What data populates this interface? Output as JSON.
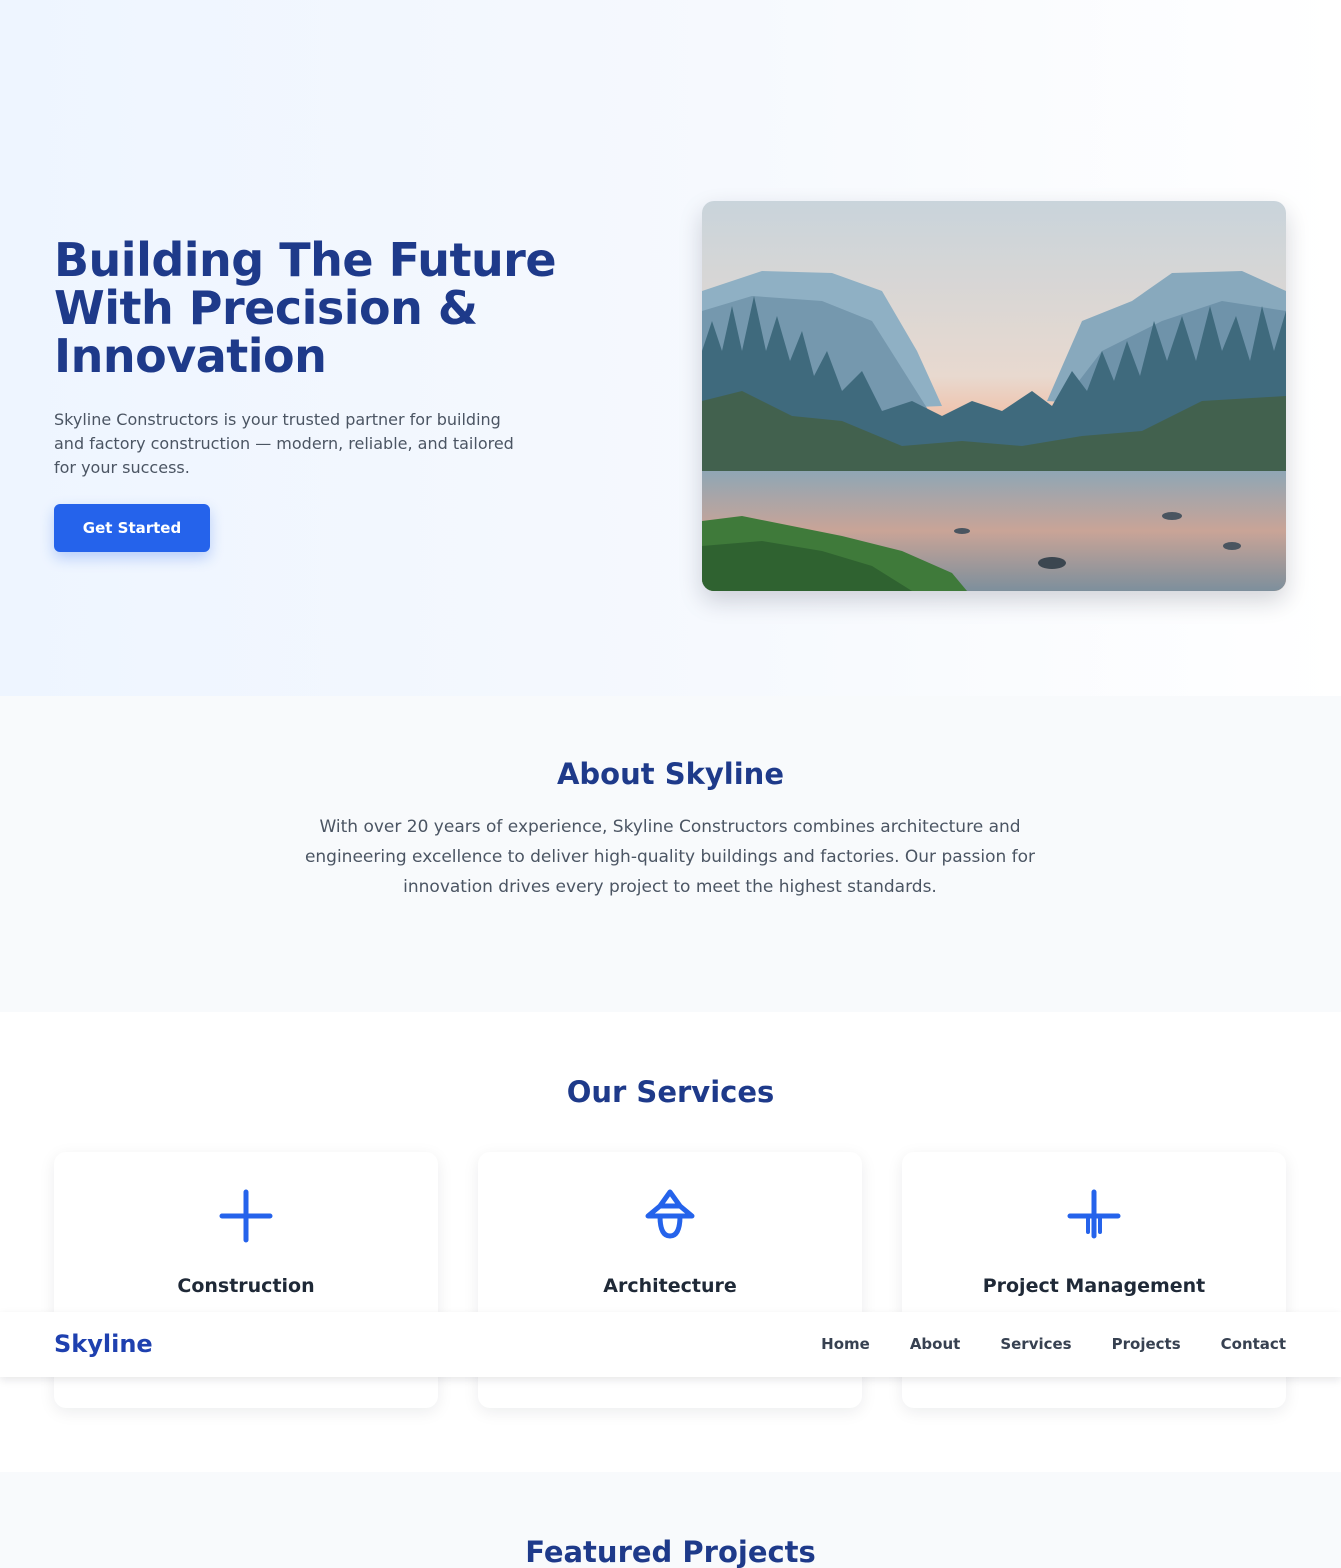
{
  "hero": {
    "title": "Building The Future With Precision & Innovation",
    "text": "Skyline Constructors is your trusted partner for building and factory construction — modern, reliable, and tailored for your success.",
    "cta_label": "Get Started"
  },
  "about": {
    "title": "About Skyline",
    "text": "With over 20 years of experience, Skyline Constructors combines architecture and engineering excellence to deliver high-quality buildings and factories. Our passion for innovation drives every project to meet the highest standards."
  },
  "services": {
    "title": "Our Services",
    "cards": [
      {
        "icon": "plus-icon",
        "title": "Construction"
      },
      {
        "icon": "architecture-icon",
        "title": "Architecture"
      },
      {
        "icon": "project-management-icon",
        "title": "Project Management"
      }
    ]
  },
  "navbar": {
    "logo": "Skyline",
    "links": [
      "Home",
      "About",
      "Services",
      "Projects",
      "Contact"
    ]
  },
  "projects": {
    "title": "Featured Projects"
  },
  "colors": {
    "primary": "#2563eb",
    "heading": "#1e3a8a",
    "logo": "#1e40af"
  }
}
